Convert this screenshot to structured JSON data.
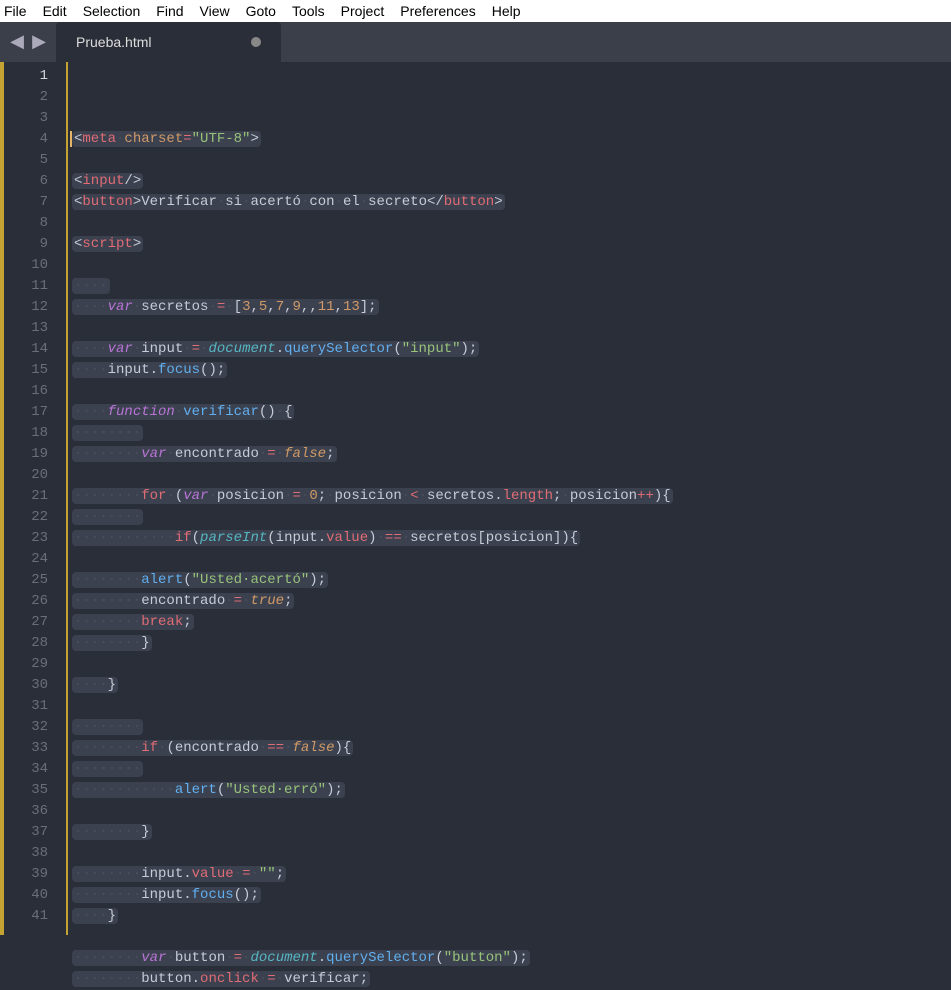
{
  "menu": [
    "File",
    "Edit",
    "Selection",
    "Find",
    "View",
    "Goto",
    "Tools",
    "Project",
    "Preferences",
    "Help"
  ],
  "tab": {
    "title": "Prueba.html",
    "dirty": true
  },
  "nav": {
    "back": "◀",
    "forward": "▶"
  },
  "code": {
    "lineCount": 41,
    "activeLine": 1,
    "lines": [
      [
        {
          "cls": "t-punc",
          "t": "<"
        },
        {
          "cls": "t-tag",
          "t": "meta"
        },
        {
          "cls": "ws",
          "t": "·"
        },
        {
          "cls": "t-attr",
          "t": "charset"
        },
        {
          "cls": "t-op",
          "t": "="
        },
        {
          "cls": "t-str",
          "t": "\"UTF-8\""
        },
        {
          "cls": "t-punc",
          "t": ">"
        }
      ],
      [],
      [
        {
          "cls": "t-punc",
          "t": "<"
        },
        {
          "cls": "t-tag",
          "t": "input"
        },
        {
          "cls": "t-punc",
          "t": "/>"
        }
      ],
      [
        {
          "cls": "t-punc",
          "t": "<"
        },
        {
          "cls": "t-tag",
          "t": "button"
        },
        {
          "cls": "t-punc",
          "t": ">"
        },
        {
          "cls": "t-text",
          "t": "Verificar"
        },
        {
          "cls": "ws",
          "t": "·"
        },
        {
          "cls": "t-text",
          "t": "si"
        },
        {
          "cls": "ws",
          "t": "·"
        },
        {
          "cls": "t-text",
          "t": "acertó"
        },
        {
          "cls": "ws",
          "t": "·"
        },
        {
          "cls": "t-text",
          "t": "con"
        },
        {
          "cls": "ws",
          "t": "·"
        },
        {
          "cls": "t-text",
          "t": "el"
        },
        {
          "cls": "ws",
          "t": "·"
        },
        {
          "cls": "t-text",
          "t": "secreto"
        },
        {
          "cls": "t-punc",
          "t": "</"
        },
        {
          "cls": "t-tag",
          "t": "button"
        },
        {
          "cls": "t-punc",
          "t": ">"
        }
      ],
      [],
      [
        {
          "cls": "t-punc",
          "t": "<"
        },
        {
          "cls": "t-tag",
          "t": "script"
        },
        {
          "cls": "t-punc",
          "t": ">"
        }
      ],
      [],
      [
        {
          "cls": "ws",
          "t": "····"
        }
      ],
      [
        {
          "cls": "ws",
          "t": "····"
        },
        {
          "cls": "t-key",
          "t": "var"
        },
        {
          "cls": "ws",
          "t": "·"
        },
        {
          "cls": "t-text",
          "t": "secretos"
        },
        {
          "cls": "ws",
          "t": "·"
        },
        {
          "cls": "t-op",
          "t": "="
        },
        {
          "cls": "ws",
          "t": "·"
        },
        {
          "cls": "t-punc",
          "t": "["
        },
        {
          "cls": "t-num",
          "t": "3"
        },
        {
          "cls": "t-punc",
          "t": ","
        },
        {
          "cls": "t-num",
          "t": "5"
        },
        {
          "cls": "t-punc",
          "t": ","
        },
        {
          "cls": "t-num",
          "t": "7"
        },
        {
          "cls": "t-punc",
          "t": ","
        },
        {
          "cls": "t-num",
          "t": "9"
        },
        {
          "cls": "t-punc",
          "t": ",,"
        },
        {
          "cls": "t-num",
          "t": "11"
        },
        {
          "cls": "t-punc",
          "t": ","
        },
        {
          "cls": "t-num",
          "t": "13"
        },
        {
          "cls": "t-punc",
          "t": "];"
        }
      ],
      [],
      [
        {
          "cls": "ws",
          "t": "····"
        },
        {
          "cls": "t-key",
          "t": "var"
        },
        {
          "cls": "ws",
          "t": "·"
        },
        {
          "cls": "t-text",
          "t": "input"
        },
        {
          "cls": "ws",
          "t": "·"
        },
        {
          "cls": "t-op",
          "t": "="
        },
        {
          "cls": "ws",
          "t": "·"
        },
        {
          "cls": "t-obj",
          "t": "document"
        },
        {
          "cls": "t-punc",
          "t": "."
        },
        {
          "cls": "t-fn",
          "t": "querySelector"
        },
        {
          "cls": "t-punc",
          "t": "("
        },
        {
          "cls": "t-str",
          "t": "\"input\""
        },
        {
          "cls": "t-punc",
          "t": ");"
        }
      ],
      [
        {
          "cls": "ws",
          "t": "····"
        },
        {
          "cls": "t-text",
          "t": "input"
        },
        {
          "cls": "t-punc",
          "t": "."
        },
        {
          "cls": "t-fn",
          "t": "focus"
        },
        {
          "cls": "t-punc",
          "t": "();"
        }
      ],
      [],
      [
        {
          "cls": "ws",
          "t": "····"
        },
        {
          "cls": "t-key",
          "t": "function"
        },
        {
          "cls": "ws",
          "t": "·"
        },
        {
          "cls": "t-fn",
          "t": "verificar"
        },
        {
          "cls": "t-punc",
          "t": "()"
        },
        {
          "cls": "ws",
          "t": "·"
        },
        {
          "cls": "t-punc",
          "t": "{"
        }
      ],
      [
        {
          "cls": "ws",
          "t": "········"
        }
      ],
      [
        {
          "cls": "ws",
          "t": "········"
        },
        {
          "cls": "t-key",
          "t": "var"
        },
        {
          "cls": "ws",
          "t": "·"
        },
        {
          "cls": "t-text",
          "t": "encontrado"
        },
        {
          "cls": "ws",
          "t": "·"
        },
        {
          "cls": "t-op",
          "t": "="
        },
        {
          "cls": "ws",
          "t": "·"
        },
        {
          "cls": "t-const",
          "t": "false"
        },
        {
          "cls": "t-punc",
          "t": ";"
        }
      ],
      [],
      [
        {
          "cls": "ws",
          "t": "········"
        },
        {
          "cls": "t-kw",
          "t": "for"
        },
        {
          "cls": "ws",
          "t": "·"
        },
        {
          "cls": "t-punc",
          "t": "("
        },
        {
          "cls": "t-key",
          "t": "var"
        },
        {
          "cls": "ws",
          "t": "·"
        },
        {
          "cls": "t-text",
          "t": "posicion"
        },
        {
          "cls": "ws",
          "t": "·"
        },
        {
          "cls": "t-op",
          "t": "="
        },
        {
          "cls": "ws",
          "t": "·"
        },
        {
          "cls": "t-num",
          "t": "0"
        },
        {
          "cls": "t-punc",
          "t": ";"
        },
        {
          "cls": "ws",
          "t": "·"
        },
        {
          "cls": "t-text",
          "t": "posicion"
        },
        {
          "cls": "ws",
          "t": "·"
        },
        {
          "cls": "t-op",
          "t": "<"
        },
        {
          "cls": "ws",
          "t": "·"
        },
        {
          "cls": "t-text",
          "t": "secretos"
        },
        {
          "cls": "t-punc",
          "t": "."
        },
        {
          "cls": "t-prop",
          "t": "length"
        },
        {
          "cls": "t-punc",
          "t": ";"
        },
        {
          "cls": "ws",
          "t": "·"
        },
        {
          "cls": "t-text",
          "t": "posicion"
        },
        {
          "cls": "t-op",
          "t": "++"
        },
        {
          "cls": "t-punc",
          "t": "){"
        }
      ],
      [
        {
          "cls": "ws",
          "t": "········"
        }
      ],
      [
        {
          "cls": "ws",
          "t": "············"
        },
        {
          "cls": "t-kw",
          "t": "if"
        },
        {
          "cls": "t-punc",
          "t": "("
        },
        {
          "cls": "t-fni",
          "t": "parseInt"
        },
        {
          "cls": "t-punc",
          "t": "("
        },
        {
          "cls": "t-text",
          "t": "input"
        },
        {
          "cls": "t-punc",
          "t": "."
        },
        {
          "cls": "t-prop",
          "t": "value"
        },
        {
          "cls": "t-punc",
          "t": ")"
        },
        {
          "cls": "ws",
          "t": "·"
        },
        {
          "cls": "t-op",
          "t": "=="
        },
        {
          "cls": "ws",
          "t": "·"
        },
        {
          "cls": "t-text",
          "t": "secretos"
        },
        {
          "cls": "t-punc",
          "t": "["
        },
        {
          "cls": "t-text",
          "t": "posicion"
        },
        {
          "cls": "t-punc",
          "t": "]){"
        }
      ],
      [],
      [
        {
          "cls": "ws",
          "t": "········"
        },
        {
          "cls": "t-fn",
          "t": "alert"
        },
        {
          "cls": "t-punc",
          "t": "("
        },
        {
          "cls": "t-str",
          "t": "\"Usted·acertó\""
        },
        {
          "cls": "t-punc",
          "t": ");"
        }
      ],
      [
        {
          "cls": "ws",
          "t": "········"
        },
        {
          "cls": "t-text",
          "t": "encontrado"
        },
        {
          "cls": "ws",
          "t": "·"
        },
        {
          "cls": "t-op",
          "t": "="
        },
        {
          "cls": "ws",
          "t": "·"
        },
        {
          "cls": "t-const",
          "t": "true"
        },
        {
          "cls": "t-punc",
          "t": ";"
        }
      ],
      [
        {
          "cls": "ws",
          "t": "········"
        },
        {
          "cls": "t-kw",
          "t": "break"
        },
        {
          "cls": "t-punc",
          "t": ";"
        }
      ],
      [
        {
          "cls": "ws",
          "t": "········"
        },
        {
          "cls": "t-punc",
          "t": "}"
        }
      ],
      [],
      [
        {
          "cls": "ws",
          "t": "····"
        },
        {
          "cls": "t-punc",
          "t": "}"
        }
      ],
      [],
      [
        {
          "cls": "ws",
          "t": "········"
        }
      ],
      [
        {
          "cls": "ws",
          "t": "········"
        },
        {
          "cls": "t-kw",
          "t": "if"
        },
        {
          "cls": "ws",
          "t": "·"
        },
        {
          "cls": "t-punc",
          "t": "("
        },
        {
          "cls": "t-text",
          "t": "encontrado"
        },
        {
          "cls": "ws",
          "t": "·"
        },
        {
          "cls": "t-op",
          "t": "=="
        },
        {
          "cls": "ws",
          "t": "·"
        },
        {
          "cls": "t-const",
          "t": "false"
        },
        {
          "cls": "t-punc",
          "t": "){"
        }
      ],
      [
        {
          "cls": "ws",
          "t": "········"
        }
      ],
      [
        {
          "cls": "ws",
          "t": "············"
        },
        {
          "cls": "t-fn",
          "t": "alert"
        },
        {
          "cls": "t-punc",
          "t": "("
        },
        {
          "cls": "t-str",
          "t": "\"Usted·erró\""
        },
        {
          "cls": "t-punc",
          "t": ");"
        }
      ],
      [],
      [
        {
          "cls": "ws",
          "t": "········"
        },
        {
          "cls": "t-punc",
          "t": "}"
        }
      ],
      [],
      [
        {
          "cls": "ws",
          "t": "········"
        },
        {
          "cls": "t-text",
          "t": "input"
        },
        {
          "cls": "t-punc",
          "t": "."
        },
        {
          "cls": "t-prop",
          "t": "value"
        },
        {
          "cls": "ws",
          "t": "·"
        },
        {
          "cls": "t-op",
          "t": "="
        },
        {
          "cls": "ws",
          "t": "·"
        },
        {
          "cls": "t-str",
          "t": "\"\""
        },
        {
          "cls": "t-punc",
          "t": ";"
        }
      ],
      [
        {
          "cls": "ws",
          "t": "········"
        },
        {
          "cls": "t-text",
          "t": "input"
        },
        {
          "cls": "t-punc",
          "t": "."
        },
        {
          "cls": "t-fn",
          "t": "focus"
        },
        {
          "cls": "t-punc",
          "t": "();"
        }
      ],
      [
        {
          "cls": "ws",
          "t": "····"
        },
        {
          "cls": "t-punc",
          "t": "}"
        }
      ],
      [],
      [
        {
          "cls": "ws",
          "t": "········"
        },
        {
          "cls": "t-key",
          "t": "var"
        },
        {
          "cls": "ws",
          "t": "·"
        },
        {
          "cls": "t-text",
          "t": "button"
        },
        {
          "cls": "ws",
          "t": "·"
        },
        {
          "cls": "t-op",
          "t": "="
        },
        {
          "cls": "ws",
          "t": "·"
        },
        {
          "cls": "t-obj",
          "t": "document"
        },
        {
          "cls": "t-punc",
          "t": "."
        },
        {
          "cls": "t-fn",
          "t": "querySelector"
        },
        {
          "cls": "t-punc",
          "t": "("
        },
        {
          "cls": "t-str",
          "t": "\"button\""
        },
        {
          "cls": "t-punc",
          "t": ");"
        }
      ],
      [
        {
          "cls": "ws",
          "t": "········"
        },
        {
          "cls": "t-text",
          "t": "button"
        },
        {
          "cls": "t-punc",
          "t": "."
        },
        {
          "cls": "t-prop",
          "t": "onclick"
        },
        {
          "cls": "ws",
          "t": "·"
        },
        {
          "cls": "t-op",
          "t": "="
        },
        {
          "cls": "ws",
          "t": "·"
        },
        {
          "cls": "t-text",
          "t": "verificar"
        },
        {
          "cls": "t-punc",
          "t": ";"
        }
      ]
    ]
  }
}
